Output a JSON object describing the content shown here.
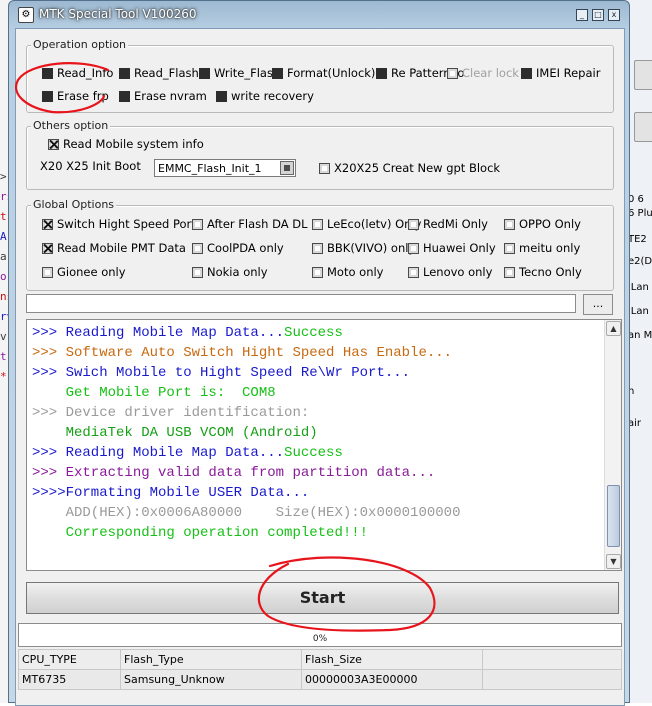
{
  "window": {
    "title": "MTK Special Tool V100260",
    "close_glyph": "x"
  },
  "background_left": [
    ">",
    "rs",
    "t",
    "A",
    "a",
    "o",
    "ns",
    "rv",
    "v",
    "t",
    "*"
  ],
  "background_right": [
    "0 6",
    "6 Plu",
    "TE2",
    "e2(D",
    "iLan",
    "iLan",
    "an M",
    "h",
    "air"
  ],
  "operation_option": {
    "title": "Operation option",
    "items": [
      {
        "label": "Read_Info",
        "checked": false,
        "disabled": false
      },
      {
        "label": "Read_Flash",
        "checked": false,
        "disabled": false
      },
      {
        "label": "Write_Flash",
        "checked": false,
        "disabled": false
      },
      {
        "label": "Format(Unlock)",
        "checked": false,
        "disabled": false
      },
      {
        "label": "Re Pattern lo",
        "checked": false,
        "disabled": false
      },
      {
        "label": "Clear lock",
        "checked": false,
        "disabled": true
      },
      {
        "label": "IMEI Repair",
        "checked": false,
        "disabled": false
      },
      {
        "label": "Erase frp",
        "checked": false,
        "disabled": false
      },
      {
        "label": "Erase nvram",
        "checked": false,
        "disabled": false
      },
      {
        "label": "write recovery",
        "checked": false,
        "disabled": false
      }
    ]
  },
  "others_option": {
    "title": "Others option",
    "read_mobile_system_info": {
      "label": "Read Mobile system info",
      "checked": true
    },
    "init_boot_label": "X20 X25 Init Boot",
    "init_boot_value": "EMMC_Flash_Init_1",
    "new_gpt": {
      "label": "X20X25 Creat New gpt Block",
      "checked": false
    }
  },
  "global_options": {
    "title": "Global Options",
    "items": [
      {
        "label": "Switch Hight Speed Port",
        "checked": true
      },
      {
        "label": "After Flash DA DL",
        "checked": false
      },
      {
        "label": "LeEco(letv) Only",
        "checked": false
      },
      {
        "label": "RedMi Only",
        "checked": false
      },
      {
        "label": "OPPO Only",
        "checked": false
      },
      {
        "label": "Read Mobile PMT Data",
        "checked": true
      },
      {
        "label": "CoolPDA only",
        "checked": false
      },
      {
        "label": "BBK(VIVO) only",
        "checked": false
      },
      {
        "label": "Huawei Only",
        "checked": false
      },
      {
        "label": "meitu only",
        "checked": false
      },
      {
        "label": "Gionee only",
        "checked": false
      },
      {
        "label": "Nokia only",
        "checked": false
      },
      {
        "label": "Moto only",
        "checked": false
      },
      {
        "label": "Lenovo only",
        "checked": false
      },
      {
        "label": "Tecno Only",
        "checked": false
      }
    ]
  },
  "file_path": {
    "value": "",
    "browse_label": "..."
  },
  "log": [
    {
      "text": ">>> Reading Mobile Map Data...",
      "color": "#1a1acd",
      "tail": "Success",
      "tail_color": "#16c016"
    },
    {
      "text": ">>> Software Auto Switch Hight Speed Has Enable...",
      "color": "#c86a10"
    },
    {
      "text": ">>> Swich Mobile to Hight Speed Re\\Wr Port...",
      "color": "#1a1acd"
    },
    {
      "text": "    Get Mobile Port is:  COM8",
      "color": "#16c016"
    },
    {
      "text": ">>> Device driver identification:",
      "color": "#9a9a9a"
    },
    {
      "text": "    MediaTek DA USB VCOM (Android)",
      "color": "#16a016"
    },
    {
      "text": ">>> Reading Mobile Map Data...",
      "color": "#1a1acd",
      "tail": "Success",
      "tail_color": "#16c016"
    },
    {
      "text": ">>> Extracting valid data from partition data...",
      "color": "#8a1a9a"
    },
    {
      "text": ">>>>Formating Mobile USER Data...",
      "color": "#1a1acd"
    },
    {
      "text": "    ADD(HEX):0x0006A80000    Size(HEX):0x0000100000",
      "color": "#9a9a9a"
    },
    {
      "text": "    Corresponding operation completed!!!",
      "color": "#16c016"
    }
  ],
  "start_button": "Start",
  "progress": {
    "percent": 0,
    "label": "0%"
  },
  "info_table": {
    "headers": [
      "CPU_TYPE",
      "Flash_Type",
      "Flash_Size",
      ""
    ],
    "values": [
      "MT6735",
      "Samsung_Unknow",
      "00000003A3E00000",
      ""
    ]
  },
  "colors": {
    "annotation": "#e8141c",
    "progress": "#3a8ee6"
  }
}
